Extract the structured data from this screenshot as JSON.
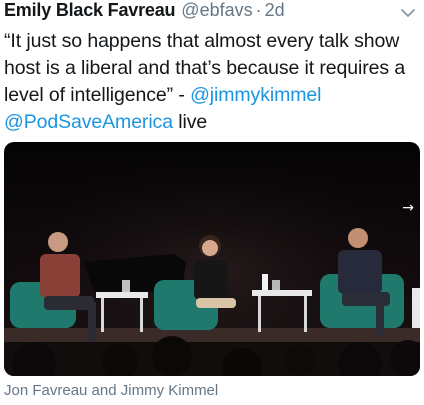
{
  "tweet": {
    "author_name": "Emily Black Favreau",
    "author_handle": "@ebfavs",
    "separator": "·",
    "timestamp": "2d",
    "text_part1": "“It just so happens that almost every talk show host is a liberal and that’s because it requires a level of intelligence” - ",
    "mention1": "@jimmykimmel",
    "text_space": " ",
    "mention2": "@PodSaveAmerica",
    "text_part2": " live"
  },
  "media": {
    "caption": "Jon Favreau and Jimmy Kimmel",
    "arrow_glyph": "→"
  },
  "icons": {
    "menu": "chevron-down-icon"
  },
  "colors": {
    "link": "#1b95e0",
    "secondary_text": "#657786",
    "stage_chair": "#1f7a6d"
  }
}
